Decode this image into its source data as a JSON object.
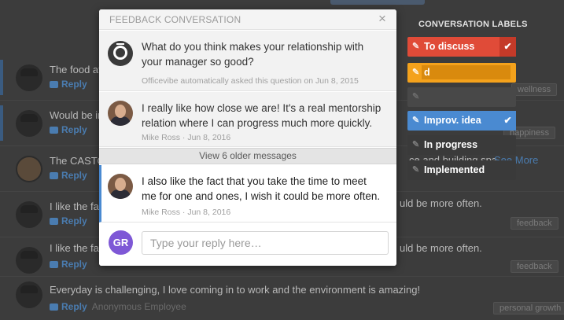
{
  "modal": {
    "title": "FEEDBACK CONVERSATION",
    "close_icon": "×",
    "messages": [
      {
        "text": "What do you think makes your relationship with your manager so good?",
        "meta": "Officevibe automatically asked this question on Jun 8, 2015",
        "avatar": "officevibe-logo"
      },
      {
        "text": "I really like how close we are! It's a real mentorship relation where I can progress much more quickly.",
        "meta": "Mike Ross · Jun 8, 2016",
        "avatar": "mike-ross-photo"
      },
      {
        "text": "I also like the fact that you take the time to meet me for one and ones, I wish it could be more often.",
        "meta": "Mike Ross · Jun 8, 2016",
        "avatar": "mike-ross-photo"
      }
    ],
    "older_messages": "View 6 older messages",
    "reply": {
      "avatar_initials": "GR",
      "avatar_color": "#7e58d6",
      "placeholder": "Type your reply here…"
    }
  },
  "labels": {
    "title": "CONVERSATION LABELS",
    "items": [
      {
        "name": "To discuss",
        "color": "#e04b38",
        "checked": true
      },
      {
        "name": "d",
        "color": "#f4a21c",
        "editing": true
      },
      {
        "name": "",
        "color": "#484848"
      },
      {
        "name": "Improv. idea",
        "color": "#4a8ad1",
        "checked": true
      },
      {
        "name": "In progress",
        "color": "#3a3a3a"
      },
      {
        "name": "Implemented",
        "color": "#3a3a3a"
      }
    ],
    "check_icon": "✔",
    "pencil_icon": "✎"
  },
  "feed": {
    "rows": [
      {
        "text": "The food at",
        "reply": "Reply",
        "tag": "wellness"
      },
      {
        "text": "Would be im",
        "reply": "Reply",
        "tag": "happiness"
      },
      {
        "text": "The CASTOR",
        "reply": "Reply",
        "extra": "ce and building spa",
        "see_more": "See More"
      },
      {
        "text": "I like the fac",
        "reply": "Reply",
        "extra": "uld be more often.",
        "tag": "feedback"
      },
      {
        "text": "I like the fac",
        "reply": "Reply",
        "extra": "uld be more often.",
        "tag": "feedback"
      },
      {
        "text": "Everyday is challenging, I love coming in to work and the environment is amazing!",
        "reply": "Reply",
        "author": "Anonymous Employee",
        "tag": "personal growth"
      }
    ]
  }
}
